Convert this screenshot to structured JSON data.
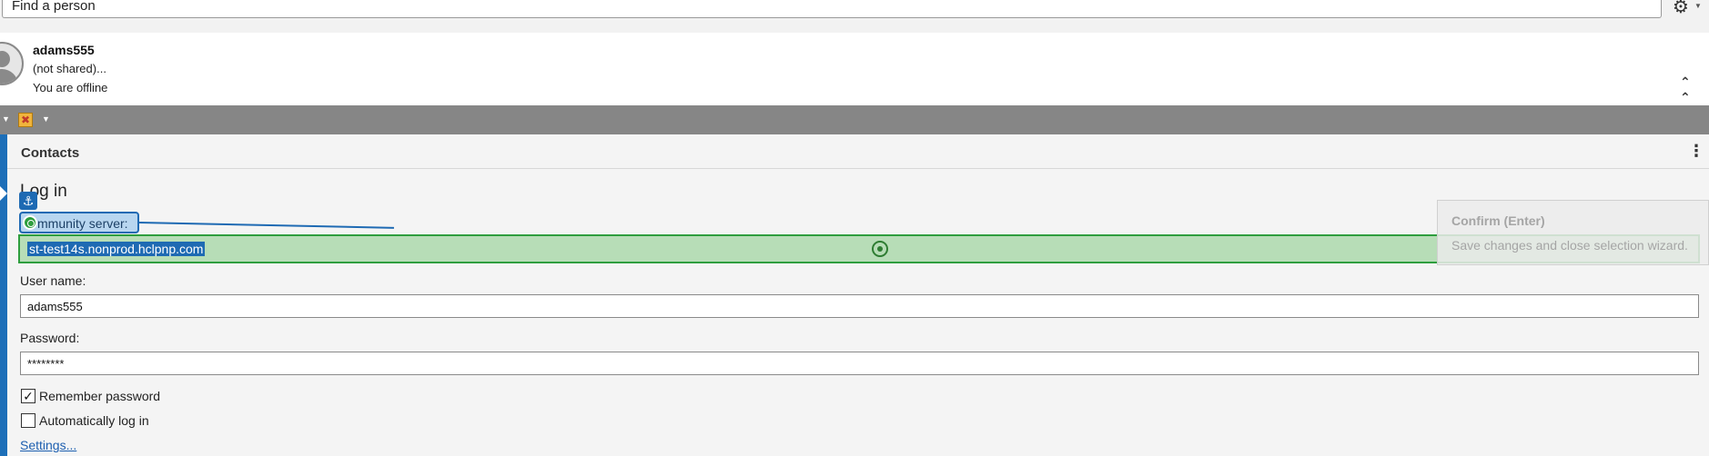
{
  "search": {
    "placeholder": "Find a person"
  },
  "profile": {
    "name": "adams555",
    "status": "(not shared)...",
    "presence": "You are offline"
  },
  "contacts": {
    "title": "Contacts"
  },
  "login": {
    "title": "Log in",
    "server_label": "mmunity server:",
    "server_value": "st-test14s.nonprod.hclpnp.com",
    "username_label": "User name:",
    "username_value": "adams555",
    "password_label": "Password:",
    "password_value": "********",
    "remember_label": "Remember password",
    "remember_checked": true,
    "autologin_label": "Automatically log in",
    "autologin_checked": false,
    "settings_link": "Settings..."
  },
  "tooltip": {
    "title": "Confirm (Enter)",
    "body": "Save changes and close selection wizard."
  },
  "icons": {
    "settings": "gear-icon",
    "collapse": "double-chevron-up-icon",
    "menu": "kebab-menu-icon",
    "anchor": "anchor-icon",
    "target": "target-icon",
    "crosshair": "crosshair-icon",
    "status_tool": "status-tool-icon"
  },
  "colors": {
    "selection_green": "#b7ddb7",
    "selection_border": "#2e9e3e",
    "accent_blue": "#1e6ab3",
    "toolbar_grey": "#868686"
  }
}
